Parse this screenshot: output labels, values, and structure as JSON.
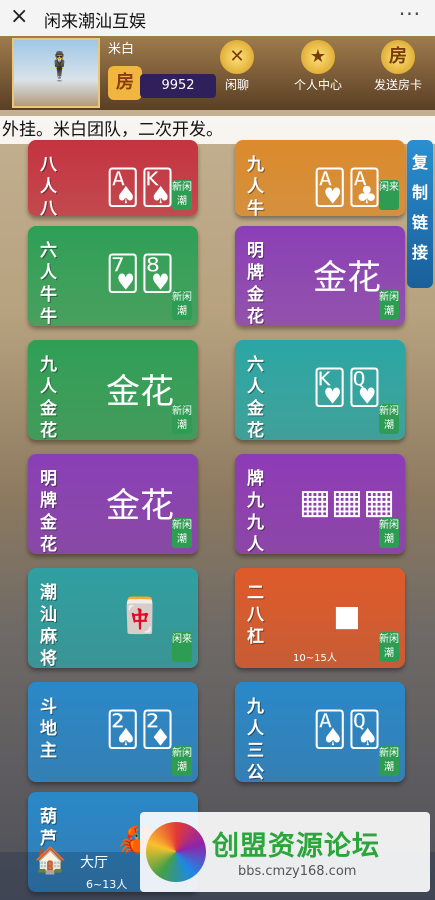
{
  "window": {
    "title": "闲来潮汕互娱",
    "close_icon": "×",
    "more_icon": "···"
  },
  "header": {
    "username": "米白",
    "room_icon": "房",
    "gold": "9952",
    "nav": [
      {
        "label": "闲聊",
        "icon": "✕"
      },
      {
        "label": "个人中心",
        "icon": "★"
      },
      {
        "label": "发送房卡",
        "icon": "房"
      }
    ]
  },
  "ticker": "外挂。米白团队，二次开发。",
  "side_tab": "复制链接",
  "games": [
    {
      "name": "八人八怪",
      "art": "🂡🂮",
      "tag": "新闲潮",
      "color": "red"
    },
    {
      "name": "九人牛牛",
      "art": "🂱🃑",
      "tag": "闲来",
      "color": "orange"
    },
    {
      "name": "六人牛牛",
      "art": "🂷🂸",
      "tag": "新闲潮",
      "color": "green"
    },
    {
      "name": "明牌金花",
      "art": "金花",
      "tag": "新闲潮",
      "color": "purple"
    },
    {
      "name": "九人金花",
      "art": "金花",
      "tag": "新闲潮",
      "color": "green"
    },
    {
      "name": "六人金花",
      "art": "🂾🂽",
      "tag": "新闲潮",
      "color": "teal"
    },
    {
      "name": "明牌金花",
      "art": "金花",
      "tag": "新闲潮",
      "color": "purple"
    },
    {
      "name": "牌九九人",
      "art": "▦▦▦",
      "tag": "新闲潮",
      "color": "violet"
    },
    {
      "name": "潮汕麻将",
      "art": "🀄",
      "tag": "闲来",
      "color": "teal2"
    },
    {
      "name": "二八杠",
      "art": "◼",
      "tag": "新闲潮",
      "color": "orangered",
      "sub": "10~15人"
    },
    {
      "name": "斗地主",
      "art": "🂢🃂",
      "tag": "新闲潮",
      "color": "blue"
    },
    {
      "name": "九人三公",
      "art": "🂡🂭",
      "tag": "新闲潮",
      "color": "blue"
    },
    {
      "name": "葫芦",
      "art": "🦀",
      "tag": "",
      "color": "blue"
    }
  ],
  "bottom": {
    "hall_label": "大厅",
    "hall_icon": "🏠",
    "hall_count": "6~13人"
  },
  "watermark": {
    "main": "创盟资源论坛",
    "url": "bbs.cmzy168.com"
  },
  "colors": {
    "red": "#c43240",
    "orange": "#db8a2b",
    "green": "#2e9f56",
    "purple": "#8a3fb6",
    "teal": "#2aa6a4",
    "violet": "#8e3bb7",
    "teal2": "#2f9fa1",
    "orangered": "#de5a2a",
    "blue": "#2a88c8"
  }
}
